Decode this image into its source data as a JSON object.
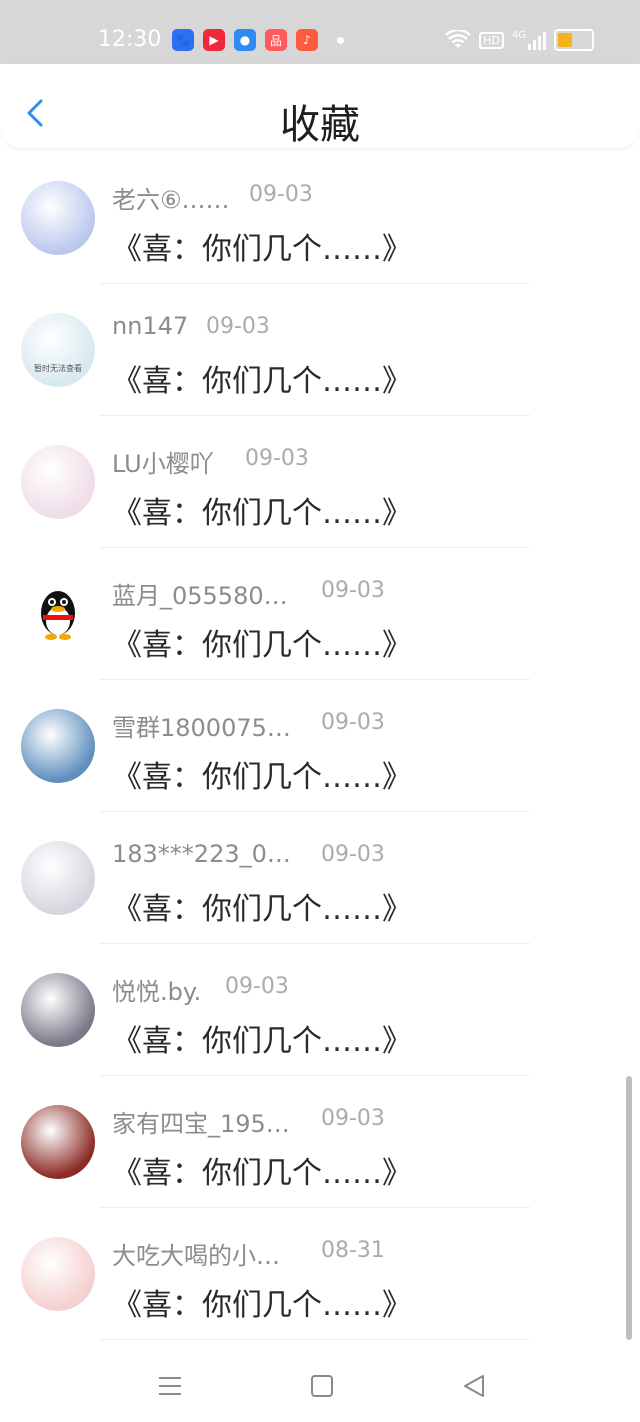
{
  "status_bar": {
    "time": "12:30",
    "hd": "HD",
    "network": "4G",
    "app_icons": [
      {
        "name": "baidu-icon",
        "color": "#2b6ff2",
        "glyph": "🐾"
      },
      {
        "name": "video-icon",
        "color": "#f0283c",
        "glyph": "▶"
      },
      {
        "name": "browser-icon",
        "color": "#2f8af2",
        "glyph": "●"
      },
      {
        "name": "app-icon",
        "color": "#ff5b5b",
        "glyph": "品"
      },
      {
        "name": "music-icon",
        "color": "#fe5a3e",
        "glyph": "♪"
      }
    ]
  },
  "header": {
    "title": "收藏"
  },
  "items": [
    {
      "name": "老六⑥……",
      "date": "09-03",
      "subtitle": "《喜：你们几个……》",
      "avatar": "#bbc7ee"
    },
    {
      "name": "nn147",
      "date": "09-03",
      "subtitle": "《喜：你们几个……》",
      "avatar": "#d7e8ef",
      "avatar_text": "暂时无法查看"
    },
    {
      "name": "LU小樱吖",
      "date": "09-03",
      "subtitle": "《喜：你们几个……》",
      "avatar": "#efdde7"
    },
    {
      "name": "蓝月_055580…",
      "date": "09-03",
      "subtitle": "《喜：你们几个……》",
      "avatar": "penguin"
    },
    {
      "name": "雪群1800075…",
      "date": "09-03",
      "subtitle": "《喜：你们几个……》",
      "avatar": "#5e8fbe"
    },
    {
      "name": "183***223_0…",
      "date": "09-03",
      "subtitle": "《喜：你们几个……》",
      "avatar": "#d8d4df"
    },
    {
      "name": "悦悦.by.",
      "date": "09-03",
      "subtitle": "《喜：你们几个……》",
      "avatar": "#7b7888"
    },
    {
      "name": "家有四宝_195…",
      "date": "09-03",
      "subtitle": "《喜：你们几个……》",
      "avatar": "#8c2b25"
    },
    {
      "name": "大吃大喝的小…",
      "date": "08-31",
      "subtitle": "《喜：你们几个……》",
      "avatar": "#f4d0cf"
    }
  ],
  "nav": [
    "menu-icon",
    "home-icon",
    "back-triangle-icon"
  ]
}
